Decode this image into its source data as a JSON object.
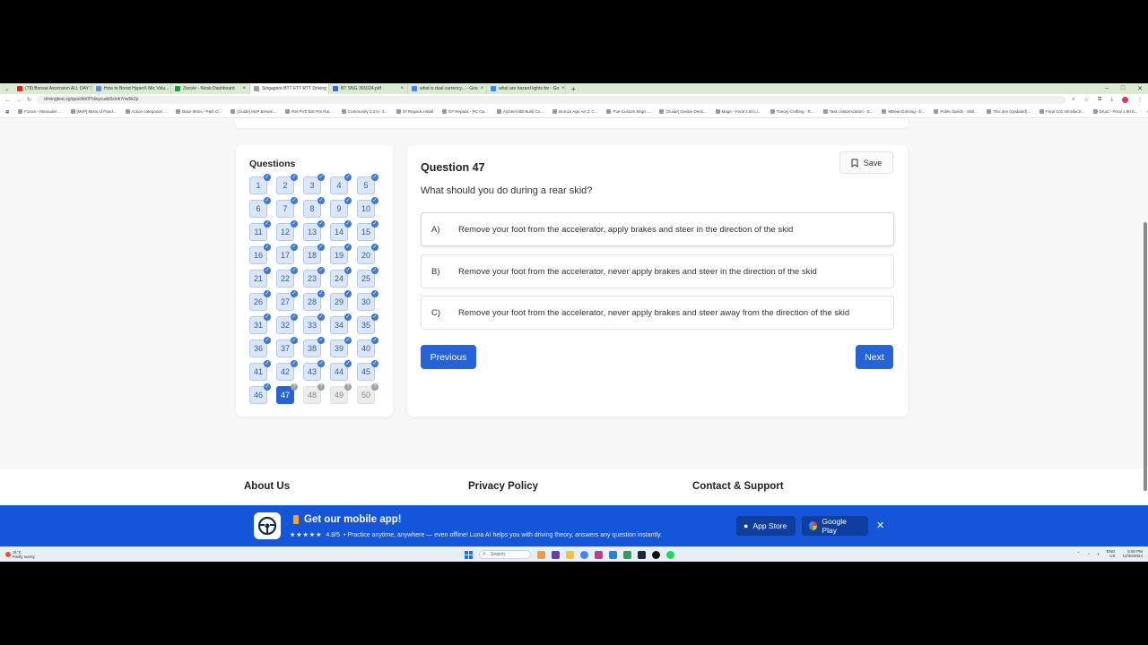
{
  "browser": {
    "tabs": [
      {
        "label": "(79) Bonsai Ascension ALL DAY !!",
        "color": "#e62117"
      },
      {
        "label": "How to Boost HyperX Mic Volu...",
        "color": "#5b8def"
      },
      {
        "label": "Zecole - Kiosk Dashboard",
        "color": "#1b9e3e"
      },
      {
        "label": "Singapore BTT FTT RTT Driving",
        "color": "#9aa0a6"
      },
      {
        "label": "BT SNG 301024.pdf",
        "color": "#3a6cc4"
      },
      {
        "label": "what is dual currency... - Goo",
        "color": "#4285f4"
      },
      {
        "label": "what are hazard lights for - Go",
        "color": "#4285f4"
      }
    ],
    "url": "drivingtest.sg/quiz/btt/2?dwycuds5ctnk7nw5k2p",
    "bookmarks": [
      "Forum - Marauder ...",
      "[MoP] Mists of Pand...",
      "Action categories ...",
      "Base Items - Path O...",
      "[Guide] MoP Brewm...",
      "Ret PVE BiS Pre Rai...",
      "Community 3.3.5 / 4...",
      "Gf Repack install",
      "GF Repack - PC Ga...",
      "Alchemi BB Build Co...",
      "Bronze Age Art 3: C...",
      "Poe Custom Maps ...",
      "[Guide] Savitar Deck...",
      "Mage - Feral 1.80 Li...",
      "Theory Crafting - R...",
      "Task customization - S...",
      "MDeanGaming - E...",
      "Public Builds - Skill...",
      "This dev (Updated)...",
      "Feral 101 Introducti...",
      "Druid - Feral 1.80 E..."
    ],
    "all_bookmarks": "All Bookmarks"
  },
  "quiz": {
    "questions_heading": "Questions",
    "current": 47,
    "answered_max": 46,
    "total": 50,
    "question_title": "Question 47",
    "save_label": "Save",
    "question_text": "What should you do during a rear skid?",
    "options": [
      {
        "key": "A)",
        "text": "Remove your foot from the accelerator, apply brakes and steer in the direction of the skid"
      },
      {
        "key": "B)",
        "text": "Remove your foot from the accelerator, never apply brakes and steer in the direction of the skid"
      },
      {
        "key": "C)",
        "text": "Remove your foot from the accelerator, never apply brakes and steer away from the direction of the skid"
      }
    ],
    "previous_label": "Previous",
    "next_label": "Next"
  },
  "footer": {
    "about": "About Us",
    "privacy": "Privacy Policy",
    "contact": "Contact & Support"
  },
  "banner": {
    "title": "Get our mobile app!",
    "stars": "★★★★★",
    "rating": "4.8/5",
    "tagline": "• Practice anytime, anywhere — even offline! Luna AI helps you with driving theory, answers any question instantly.",
    "app_store": "App Store",
    "google_play": "Google Play",
    "close": "✕",
    "color": "#1556d8"
  },
  "taskbar": {
    "weather_temp": "31°C",
    "weather_desc": "Partly sunny",
    "search": "Search",
    "lang": "ENG",
    "lang_sub": "US",
    "time": "5:50 PM",
    "date": "12/30/2024"
  }
}
